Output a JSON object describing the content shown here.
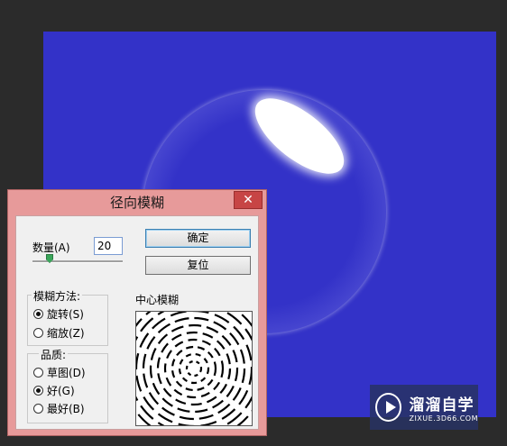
{
  "dialog": {
    "title": "径向模糊",
    "close_label": "✕",
    "amount_label": "数量(A)",
    "amount_value": "20",
    "amount_slider_fraction": 0.2,
    "ok_label": "确定",
    "reset_label": "复位",
    "blur_method": {
      "title": "模糊方法:",
      "options": [
        {
          "label": "旋转(S)",
          "checked": true
        },
        {
          "label": "缩放(Z)",
          "checked": false
        }
      ]
    },
    "quality": {
      "title": "品质:",
      "options": [
        {
          "label": "草图(D)",
          "checked": false
        },
        {
          "label": "好(G)",
          "checked": true
        },
        {
          "label": "最好(B)",
          "checked": false
        }
      ]
    },
    "center_label": "中心模糊"
  },
  "canvas": {
    "color": "#3332c8"
  },
  "watermark": {
    "name": "溜溜自学",
    "url": "ZIXUE.3D66.COM"
  }
}
